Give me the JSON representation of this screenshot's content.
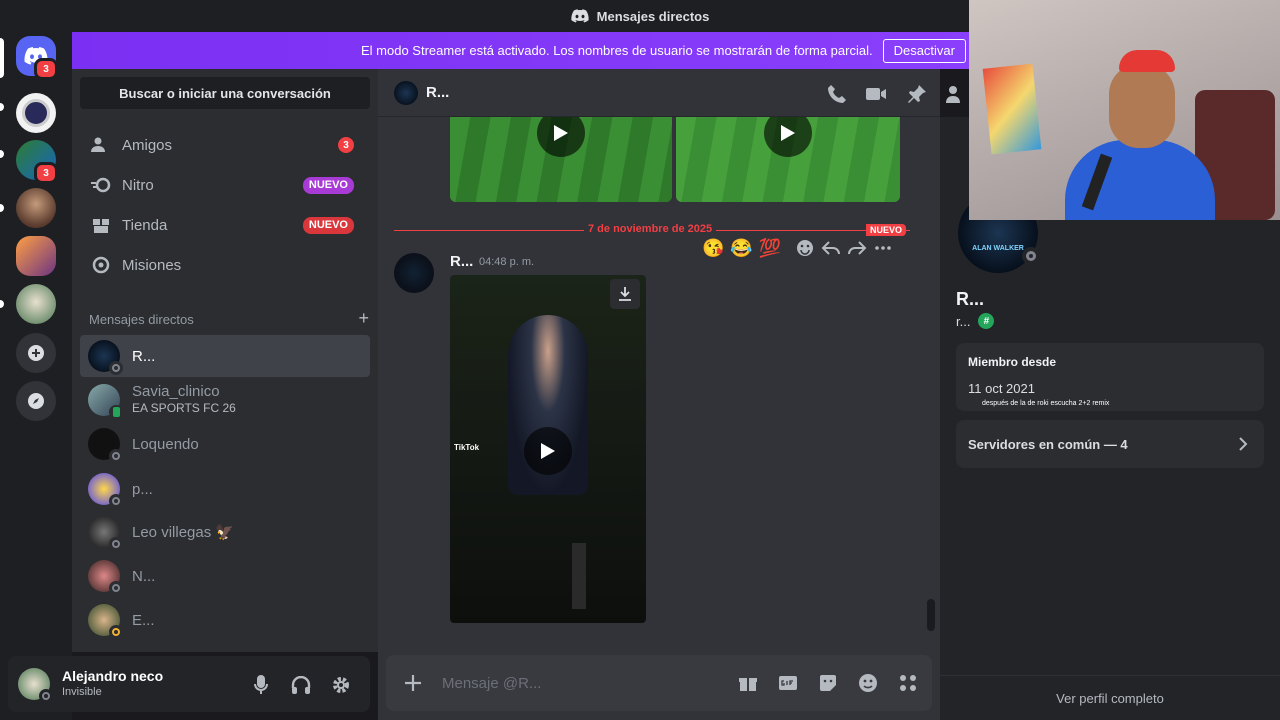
{
  "window": {
    "title": "Mensajes directos"
  },
  "banner": {
    "text": "El modo Streamer está activado. Los nombres de usuario se mostrarán de forma parcial.",
    "button": "Desactivar"
  },
  "servers": {
    "home_badge": "3",
    "server3_badge": "3"
  },
  "search": {
    "label": "Buscar o iniciar una conversación"
  },
  "nav": [
    {
      "label": "Amigos",
      "badge": "3",
      "icon": "friends-icon"
    },
    {
      "label": "Nitro",
      "badge": "NUEVO",
      "icon": "nitro-icon"
    },
    {
      "label": "Tienda",
      "badge": "NUEVO",
      "icon": "shop-icon"
    },
    {
      "label": "Misiones",
      "icon": "quests-icon"
    }
  ],
  "dm_header": {
    "label": "Mensajes directos",
    "add": "+"
  },
  "dms": [
    {
      "name": "R...",
      "sub": ""
    },
    {
      "name": "Savia_clinico",
      "sub": "EA SPORTS FC 26"
    },
    {
      "name": "Loquendo",
      "sub": ""
    },
    {
      "name": "p...",
      "sub": ""
    },
    {
      "name": "Leo villegas 🦅",
      "sub": ""
    },
    {
      "name": "N...",
      "sub": ""
    },
    {
      "name": "E...",
      "sub": ""
    }
  ],
  "user": {
    "name": "Alejandro neco",
    "status": "Invisible"
  },
  "chat": {
    "title": "R...",
    "divider_date": "7 de noviembre de 2025",
    "new_tag": "NUEVO",
    "reactions": [
      "😘",
      "😂",
      "💯"
    ],
    "message": {
      "author": "R...",
      "time": "04:48 p. m."
    },
    "tiktok_label": "TikTok",
    "composer_placeholder": "Mensaje @R..."
  },
  "profile": {
    "name": "R...",
    "username": "r...",
    "member_since_label": "Miembro desde",
    "member_since": "11 oct 2021",
    "activity": "después de la de roki escucha 2+2 remix",
    "mutual_servers": "Servidores en común — 4",
    "full_profile": "Ver perfil completo",
    "avatar_text": "ALAN WALKER"
  },
  "colors": {
    "brand": "#5865f2",
    "danger": "#f23f43",
    "nuevo": "#a83ad6",
    "banner": "#8a3ffc"
  }
}
